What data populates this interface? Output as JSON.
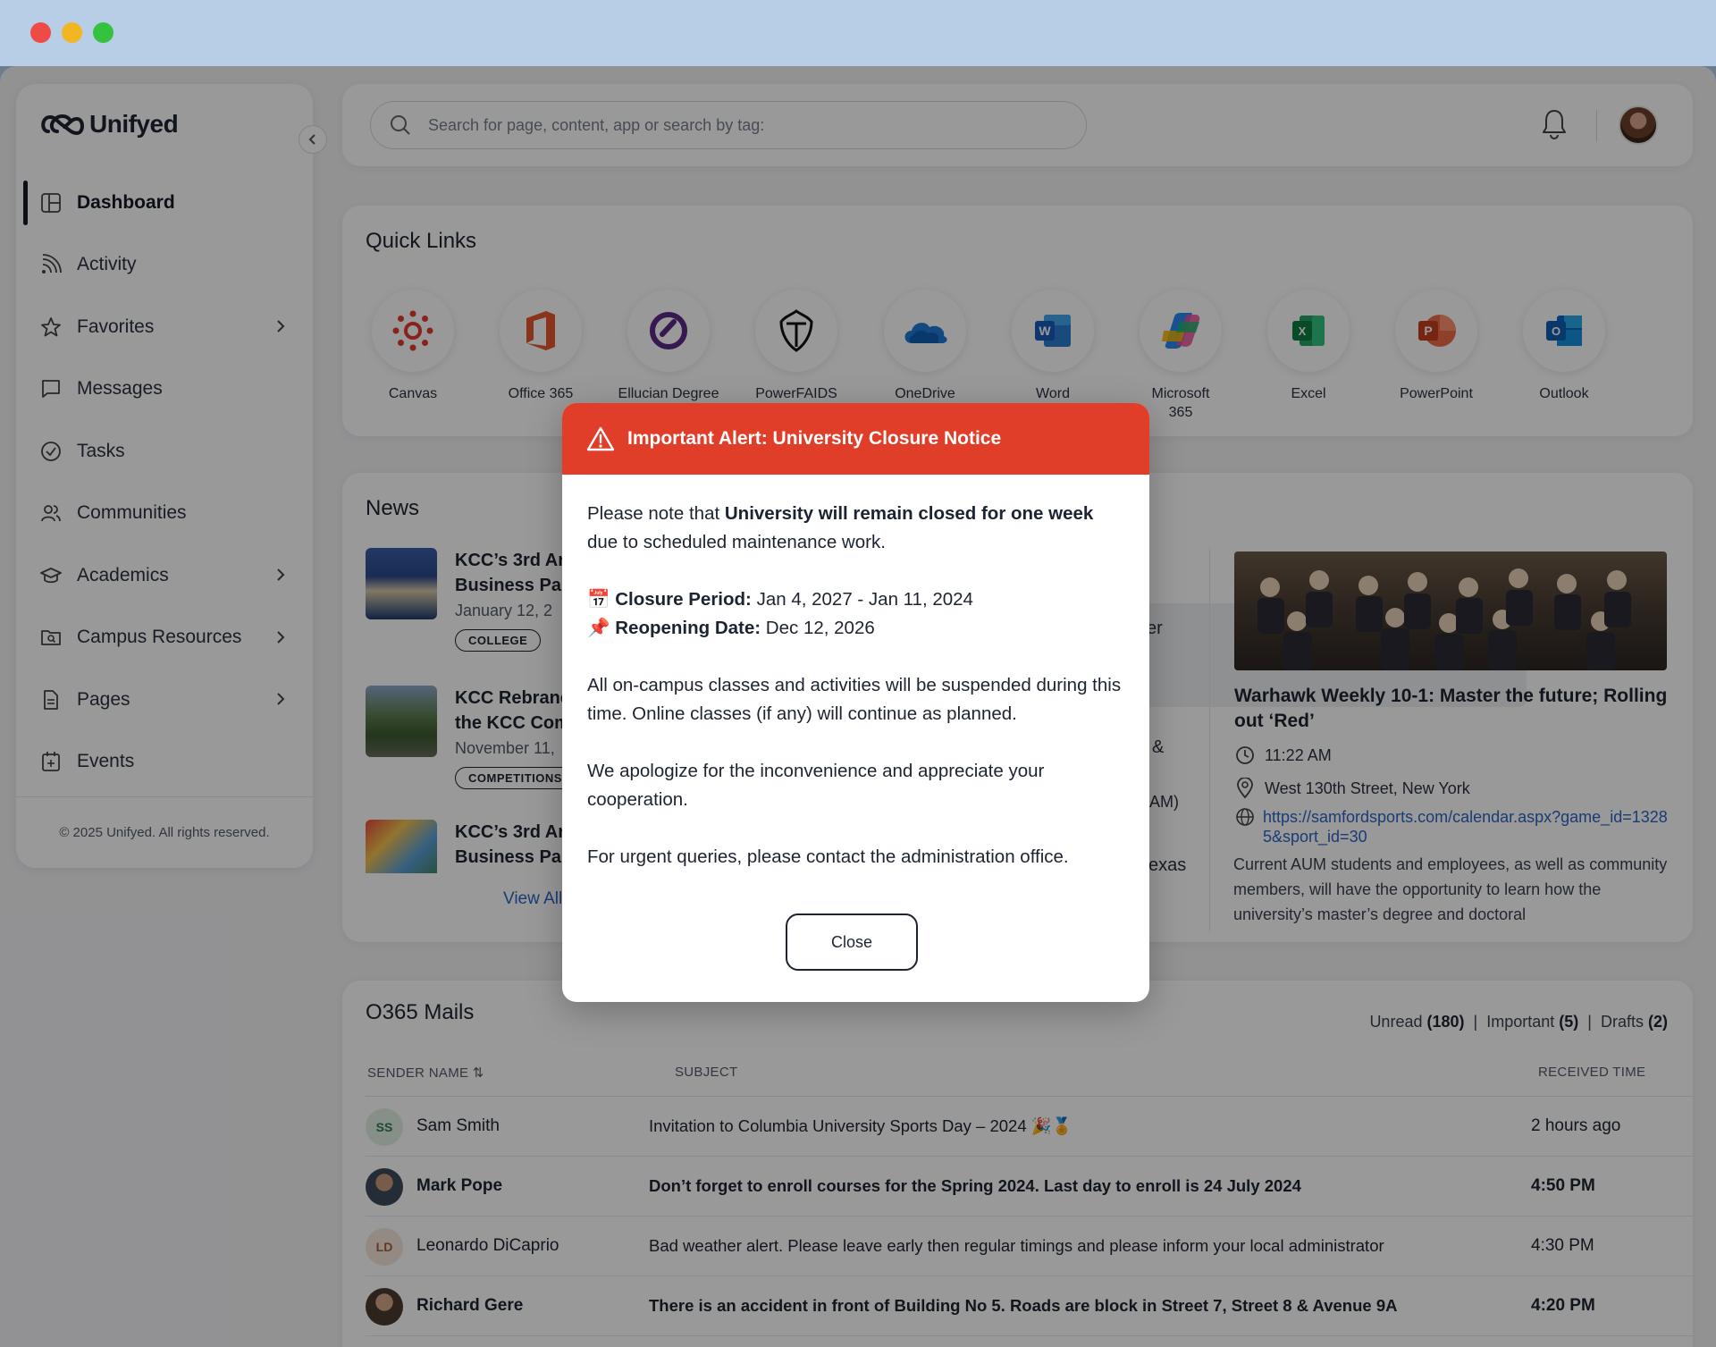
{
  "brand": {
    "name": "Unifyed"
  },
  "sidebar": {
    "items": [
      {
        "label": "Dashboard",
        "icon": "dashboard-icon",
        "active": true,
        "has_children": false
      },
      {
        "label": "Activity",
        "icon": "rss-icon",
        "has_children": false
      },
      {
        "label": "Favorites",
        "icon": "star-icon",
        "has_children": true
      },
      {
        "label": "Messages",
        "icon": "message-icon",
        "has_children": false
      },
      {
        "label": "Tasks",
        "icon": "check-circle-icon",
        "has_children": false
      },
      {
        "label": "Communities",
        "icon": "users-icon",
        "has_children": false
      },
      {
        "label": "Academics",
        "icon": "graduation-cap-icon",
        "has_children": true
      },
      {
        "label": "Campus Resources",
        "icon": "folder-search-icon",
        "has_children": true
      },
      {
        "label": "Pages",
        "icon": "document-icon",
        "has_children": true
      },
      {
        "label": "Events",
        "icon": "calendar-icon",
        "has_children": false
      }
    ],
    "footer": "© 2025 Unifyed. All rights reserved."
  },
  "search": {
    "placeholder": "Search for page, content, app or search by tag:"
  },
  "quick_links": {
    "title": "Quick Links",
    "items": [
      {
        "label": "Canvas",
        "icon": "canvas-icon"
      },
      {
        "label": "Office 365",
        "icon": "office365-icon"
      },
      {
        "label": "Ellucian Degree",
        "icon": "ellucian-icon"
      },
      {
        "label": "PowerFAIDS",
        "icon": "powerfaids-icon"
      },
      {
        "label": "OneDrive",
        "icon": "onedrive-icon"
      },
      {
        "label": "Word",
        "icon": "word-icon"
      },
      {
        "label": "Microsoft 365",
        "icon": "microsoft365-icon"
      },
      {
        "label": "Excel",
        "icon": "excel-icon"
      },
      {
        "label": "PowerPoint",
        "icon": "powerpoint-icon"
      },
      {
        "label": "Outlook",
        "icon": "outlook-icon"
      }
    ]
  },
  "news": {
    "title": "News",
    "items": [
      {
        "title_1": "KCC’s 3rd An",
        "title_2": "Business Pa",
        "date": "January 12, 2",
        "tag": "COLLEGE"
      },
      {
        "title_1": "KCC Rebranc",
        "title_2": "the KCC Com",
        "date": "November 11,",
        "tag": "COMPETITIONS"
      },
      {
        "title_1": "KCC’s 3rd An",
        "title_2": "Business Pa"
      }
    ],
    "view_all": "View All",
    "middle_fragments": [
      "er",
      "&",
      "AM)",
      "exas"
    ],
    "featured": {
      "title": "Warhawk Weekly 10-1: Master the future; Rolling out ‘Red’",
      "time": "11:22 AM",
      "location": "West 130th Street, New York",
      "link": "https://samfordsports.com/calendar.aspx?game_id=13285&sport_id=30",
      "description": "Current AUM students and employees, as well as community members, will have the opportunity to learn how the university’s master’s degree and doctoral"
    }
  },
  "mails": {
    "title": "O365 Mails",
    "unread_label": "Unread",
    "unread_count": "(180)",
    "important_label": "Important",
    "important_count": "(5)",
    "drafts_label": "Drafts",
    "drafts_count": "(2)",
    "columns": {
      "sender": "SENDER NAME ⇅",
      "subject": "SUBJECT",
      "received": "RECEIVED TIME"
    },
    "rows": [
      {
        "initials": "SS",
        "sender": "Sam Smith",
        "subject": "Invitation to Columbia University Sports Day – 2024 🎉🏅",
        "time": "2 hours ago",
        "unread": false,
        "avatar_color": "#dff1e4",
        "initials_color": "#2e7d4a"
      },
      {
        "initials": "",
        "sender": "Mark Pope",
        "subject": "Don’t forget to enroll courses for the Spring 2024. Last day to enroll is 24 July 2024",
        "time": "4:50 PM",
        "unread": true,
        "photo": true
      },
      {
        "initials": "LD",
        "sender": "Leonardo DiCaprio",
        "subject": "Bad weather alert. Please leave early then regular timings and please inform your local administrator",
        "time": "4:30 PM",
        "unread": false,
        "avatar_color": "#f5e6da",
        "initials_color": "#a0623a"
      },
      {
        "initials": "",
        "sender": "Richard Gere",
        "subject": "There is an accident in front of Building No 5. Roads are block in Street 7, Street 8 & Avenue 9A",
        "time": "4:20 PM",
        "unread": true,
        "photo": true
      }
    ]
  },
  "alert": {
    "title": "Important Alert: University Closure Notice",
    "intro_pre": "Please note that ",
    "intro_bold": "University will remain closed for one week",
    "intro_post": " due to scheduled maintenance work.",
    "closure_icon": "📅",
    "closure_label": "Closure Period:",
    "closure_value": " Jan 4, 2027 - Jan 11, 2024",
    "reopen_icon": "📌",
    "reopen_label": "Reopening Date:",
    "reopen_value": " Dec 12, 2026",
    "para2": "All on-campus classes and activities will be suspended during this time. Online classes (if any) will continue as planned.",
    "para3": "We apologize for the inconvenience and appreciate your cooperation.",
    "para4": "For urgent queries, please contact the administration office.",
    "close_label": "Close",
    "header_color": "#e13e2a"
  }
}
